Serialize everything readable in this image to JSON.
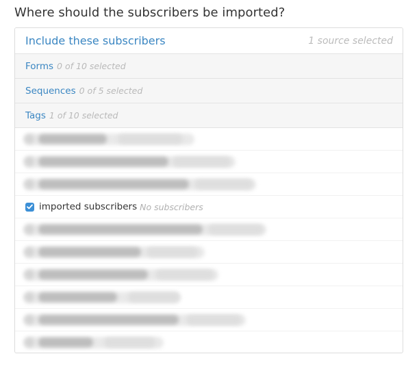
{
  "question": "Where should the subscribers be imported?",
  "panel": {
    "title": "Include these subscribers",
    "source_count": "1 source selected"
  },
  "sections": [
    {
      "label": "Forms",
      "count": "0 of 10 selected"
    },
    {
      "label": "Sequences",
      "count": "0 of 5 selected"
    },
    {
      "label": "Tags",
      "count": "1 of 10 selected"
    }
  ],
  "tags": {
    "visible_item": {
      "name": "imported subscribers",
      "count": "No subscribers",
      "checked": true
    },
    "blurred_item_count": 9
  },
  "colors": {
    "accent": "#3a86c2",
    "checkbox": "#3c8fd6",
    "section_bg": "#f6f6f6",
    "muted": "#b9b9b9"
  }
}
